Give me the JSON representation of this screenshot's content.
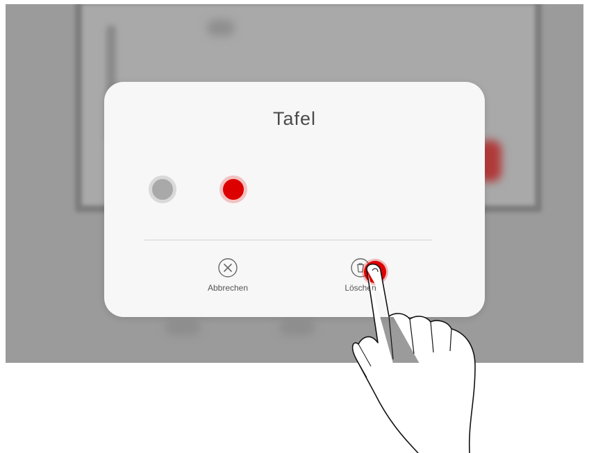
{
  "dialog": {
    "title": "Tafel",
    "colors": [
      "#a9a9a9",
      "#dd0000"
    ],
    "actions": {
      "cancel": {
        "label": "Abbrechen",
        "icon": "close-circle-icon"
      },
      "delete": {
        "label": "Löschen",
        "icon": "trash-icon"
      }
    }
  },
  "accent_color": "#dd0000"
}
